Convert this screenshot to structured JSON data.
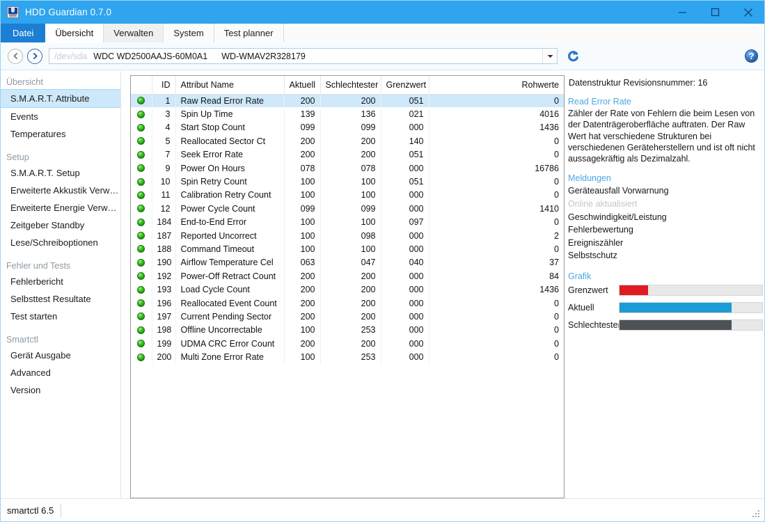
{
  "window": {
    "title": "HDD Guardian 0.7.0",
    "icon": "hdd-guardian-icon",
    "minimize": "minimize-icon",
    "maximize": "maximize-icon",
    "close": "close-icon"
  },
  "tabs": [
    {
      "label": "Datei",
      "state": "file"
    },
    {
      "label": "Übersicht",
      "state": "active"
    },
    {
      "label": "Verwalten",
      "state": "alt"
    },
    {
      "label": "System",
      "state": "plain"
    },
    {
      "label": "Test planner",
      "state": "plain"
    }
  ],
  "toolbar": {
    "back_icon": "back-arrow-icon",
    "forward_icon": "forward-arrow-icon",
    "device_path": "/dev/sda",
    "device_model": "WDC WD2500AAJS-60M0A1",
    "device_serial": "WD-WMAV2R328179",
    "dropdown_icon": "chevron-down-icon",
    "refresh_icon": "refresh-icon",
    "help_label": "?"
  },
  "sidebar": {
    "groups": [
      {
        "title": "Übersicht",
        "items": [
          {
            "label": "S.M.A.R.T. Attribute",
            "selected": true
          },
          {
            "label": "Events",
            "selected": false
          },
          {
            "label": "Temperatures",
            "selected": false
          }
        ]
      },
      {
        "title": "Setup",
        "items": [
          {
            "label": "S.M.A.R.T. Setup",
            "selected": false
          },
          {
            "label": "Erweiterte Akkustik Verw…",
            "selected": false
          },
          {
            "label": "Erweiterte Energie Verw…",
            "selected": false
          },
          {
            "label": "Zeitgeber Standby",
            "selected": false
          },
          {
            "label": "Lese/Schreiboptionen",
            "selected": false
          }
        ]
      },
      {
        "title": "Fehler und Tests",
        "items": [
          {
            "label": "Fehlerbericht",
            "selected": false
          },
          {
            "label": "Selbsttest Resultate",
            "selected": false
          },
          {
            "label": "Test starten",
            "selected": false
          }
        ]
      },
      {
        "title": "Smartctl",
        "items": [
          {
            "label": "Gerät Ausgabe",
            "selected": false
          },
          {
            "label": "Advanced",
            "selected": false
          },
          {
            "label": "Version",
            "selected": false
          }
        ]
      }
    ]
  },
  "table": {
    "columns": [
      "",
      "ID",
      "Attribut Name",
      "Aktuell",
      "Schlechtester",
      "Grenzwert",
      "Rohwerte"
    ],
    "rows": [
      {
        "status": "ok",
        "id": "1",
        "name": "Raw Read Error Rate",
        "current": "200",
        "worst": "200",
        "threshold": "051",
        "raw": "0",
        "selected": true
      },
      {
        "status": "ok",
        "id": "3",
        "name": "Spin Up Time",
        "current": "139",
        "worst": "136",
        "threshold": "021",
        "raw": "4016",
        "selected": false
      },
      {
        "status": "ok",
        "id": "4",
        "name": "Start Stop Count",
        "current": "099",
        "worst": "099",
        "threshold": "000",
        "raw": "1436",
        "selected": false
      },
      {
        "status": "ok",
        "id": "5",
        "name": "Reallocated Sector Ct",
        "current": "200",
        "worst": "200",
        "threshold": "140",
        "raw": "0",
        "selected": false
      },
      {
        "status": "ok",
        "id": "7",
        "name": "Seek Error Rate",
        "current": "200",
        "worst": "200",
        "threshold": "051",
        "raw": "0",
        "selected": false
      },
      {
        "status": "ok",
        "id": "9",
        "name": "Power On Hours",
        "current": "078",
        "worst": "078",
        "threshold": "000",
        "raw": "16786",
        "selected": false
      },
      {
        "status": "ok",
        "id": "10",
        "name": "Spin Retry Count",
        "current": "100",
        "worst": "100",
        "threshold": "051",
        "raw": "0",
        "selected": false
      },
      {
        "status": "ok",
        "id": "11",
        "name": "Calibration Retry Count",
        "current": "100",
        "worst": "100",
        "threshold": "000",
        "raw": "0",
        "selected": false
      },
      {
        "status": "ok",
        "id": "12",
        "name": "Power Cycle Count",
        "current": "099",
        "worst": "099",
        "threshold": "000",
        "raw": "1410",
        "selected": false
      },
      {
        "status": "ok",
        "id": "184",
        "name": "End-to-End Error",
        "current": "100",
        "worst": "100",
        "threshold": "097",
        "raw": "0",
        "selected": false
      },
      {
        "status": "ok",
        "id": "187",
        "name": "Reported Uncorrect",
        "current": "100",
        "worst": "098",
        "threshold": "000",
        "raw": "2",
        "selected": false
      },
      {
        "status": "ok",
        "id": "188",
        "name": "Command Timeout",
        "current": "100",
        "worst": "100",
        "threshold": "000",
        "raw": "0",
        "selected": false
      },
      {
        "status": "ok",
        "id": "190",
        "name": "Airflow Temperature Cel",
        "current": "063",
        "worst": "047",
        "threshold": "040",
        "raw": "37",
        "selected": false
      },
      {
        "status": "ok",
        "id": "192",
        "name": "Power-Off Retract Count",
        "current": "200",
        "worst": "200",
        "threshold": "000",
        "raw": "84",
        "selected": false
      },
      {
        "status": "ok",
        "id": "193",
        "name": "Load Cycle Count",
        "current": "200",
        "worst": "200",
        "threshold": "000",
        "raw": "1436",
        "selected": false
      },
      {
        "status": "ok",
        "id": "196",
        "name": "Reallocated Event Count",
        "current": "200",
        "worst": "200",
        "threshold": "000",
        "raw": "0",
        "selected": false
      },
      {
        "status": "ok",
        "id": "197",
        "name": "Current Pending Sector",
        "current": "200",
        "worst": "200",
        "threshold": "000",
        "raw": "0",
        "selected": false
      },
      {
        "status": "ok",
        "id": "198",
        "name": "Offline Uncorrectable",
        "current": "100",
        "worst": "253",
        "threshold": "000",
        "raw": "0",
        "selected": false
      },
      {
        "status": "ok",
        "id": "199",
        "name": "UDMA CRC Error Count",
        "current": "200",
        "worst": "200",
        "threshold": "000",
        "raw": "0",
        "selected": false
      },
      {
        "status": "ok",
        "id": "200",
        "name": "Multi Zone Error Rate",
        "current": "100",
        "worst": "253",
        "threshold": "000",
        "raw": "0",
        "selected": false
      }
    ]
  },
  "info": {
    "revision": "Datenstruktur Revisionsnummer: 16",
    "attribute_heading": "Read Error Rate",
    "attribute_description": "Zähler der Rate von Fehlern die beim Lesen von der Datenträgeroberfläche auftraten. Der Raw Wert hat verschiedene Strukturen bei verschiedenen Geräteherstellern und ist oft nicht aussagekräftig als Dezimalzahl.",
    "messages_heading": "Meldungen",
    "messages": [
      {
        "label": "Geräteausfall Vorwarnung",
        "dim": false
      },
      {
        "label": "Online aktualisiert",
        "dim": true
      },
      {
        "label": "Geschwindigkeit/Leistung",
        "dim": false
      },
      {
        "label": "Fehlerbewertung",
        "dim": false
      },
      {
        "label": "Ereigniszähler",
        "dim": false
      },
      {
        "label": "Selbstschutz",
        "dim": false
      }
    ],
    "graph_heading": "Grafik",
    "graph_bars": [
      {
        "label": "Grenzwert",
        "value": 51,
        "max": 255,
        "color": "#e01b22"
      },
      {
        "label": "Aktuell",
        "value": 200,
        "max": 255,
        "color": "#1b9bd8"
      },
      {
        "label": "Schlechtester",
        "value": 200,
        "max": 255,
        "color": "#4d5255"
      }
    ]
  },
  "statusbar": {
    "text": "smartctl 6.5",
    "grip": "resize-grip-icon"
  },
  "colors": {
    "titlebar": "#2fa4ef",
    "tabstrip": "#1b7fd4",
    "accent_heading": "#4aa8e0",
    "row_selected": "#cfe8fa",
    "sidebar_selected": "#cde8fb"
  }
}
